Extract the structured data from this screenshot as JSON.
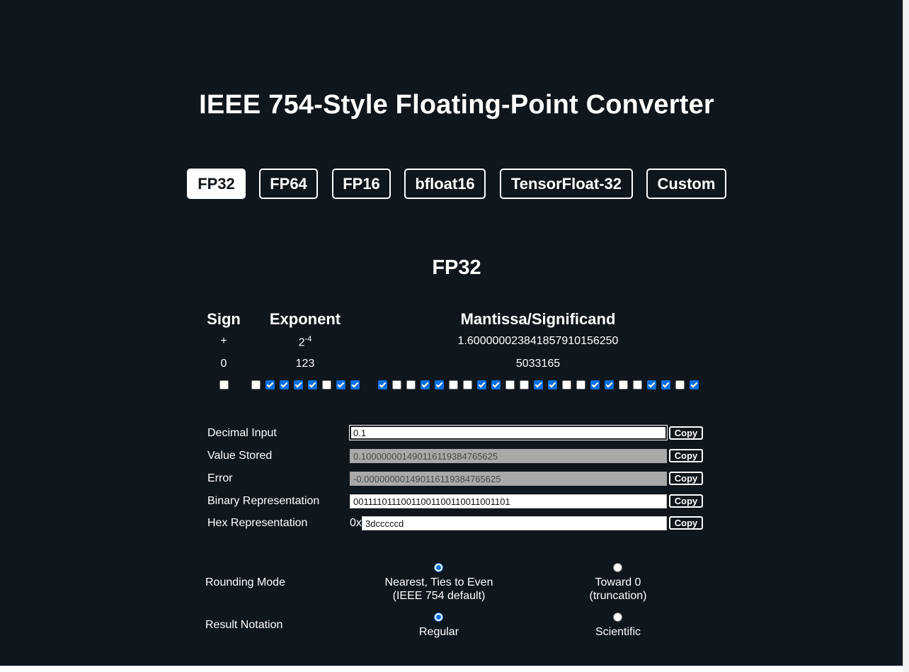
{
  "title": "IEEE 754-Style Floating-Point Converter",
  "tabs": [
    {
      "label": "FP32",
      "active": true
    },
    {
      "label": "FP64",
      "active": false
    },
    {
      "label": "FP16",
      "active": false
    },
    {
      "label": "bfloat16",
      "active": false
    },
    {
      "label": "TensorFloat-32",
      "active": false
    },
    {
      "label": "Custom",
      "active": false
    }
  ],
  "format_title": "FP32",
  "columns": {
    "sign": {
      "header": "Sign",
      "symbol": "+",
      "raw": "0"
    },
    "exponent": {
      "header": "Exponent",
      "base": "2",
      "power": "-4",
      "raw": "123"
    },
    "mantissa": {
      "header": "Mantissa/Significand",
      "value": "1.600000023841857910156250",
      "raw": "5033165"
    }
  },
  "bits": {
    "sign": [
      0
    ],
    "exponent": [
      0,
      1,
      1,
      1,
      1,
      0,
      1,
      1
    ],
    "mantissa": [
      1,
      0,
      0,
      1,
      1,
      0,
      0,
      1,
      1,
      0,
      0,
      1,
      1,
      0,
      0,
      1,
      1,
      0,
      0,
      1,
      1,
      0,
      1
    ]
  },
  "fields": {
    "decimal_input": {
      "label": "Decimal Input",
      "value": "0.1"
    },
    "value_stored": {
      "label": "Value Stored",
      "value": "0.100000001490116119384765625"
    },
    "error": {
      "label": "Error",
      "value": "-0.000000001490116119384765625"
    },
    "binary": {
      "label": "Binary Representation",
      "value": "00111101110011001100110011001101"
    },
    "hex": {
      "label": "Hex Representation",
      "prefix": "0x",
      "value": "3dcccccd"
    },
    "copy_label": "Copy"
  },
  "rounding": {
    "label": "Rounding Mode",
    "options": [
      {
        "line1": "Nearest, Ties to Even",
        "line2": "(IEEE 754 default)",
        "selected": true
      },
      {
        "line1": "Toward 0",
        "line2": "(truncation)",
        "selected": false
      }
    ]
  },
  "notation": {
    "label": "Result Notation",
    "options": [
      {
        "label": "Regular",
        "selected": true
      },
      {
        "label": "Scientific",
        "selected": false
      }
    ]
  },
  "colors": {
    "background": "#0f161c",
    "checkbox_on": "#0b6fe0",
    "text": "#ffffff"
  }
}
